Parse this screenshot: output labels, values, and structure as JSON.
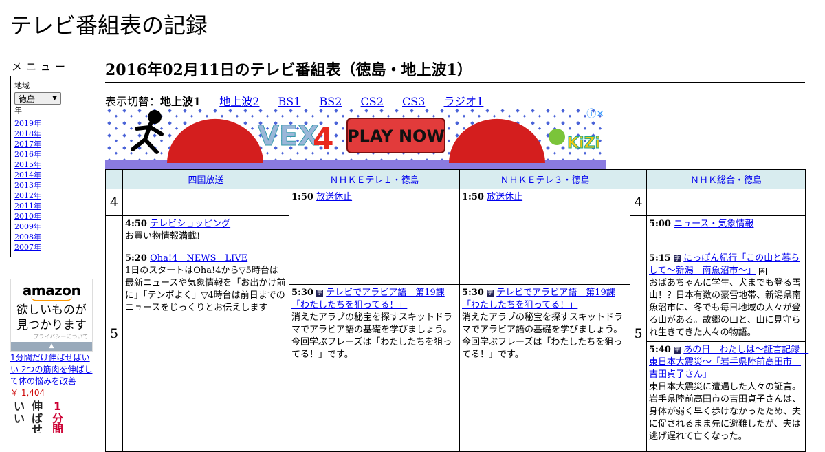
{
  "site_title": "テレビ番組表の記録",
  "menu": {
    "title": "メニュー",
    "region_label": "地域",
    "region_value": "徳島",
    "year_label": "年",
    "years": [
      "2019年",
      "2018年",
      "2017年",
      "2016年",
      "2015年",
      "2014年",
      "2013年",
      "2012年",
      "2011年",
      "2010年",
      "2009年",
      "2008年",
      "2007年"
    ]
  },
  "ads": {
    "amazon_logo": "amazon",
    "amazon_text_1": "欲しいものが",
    "amazon_text_2": "見つかります",
    "amazon_privacy": "プライバシーについて",
    "product_title": "1分間だけ伸ばせばいい 2つの筋肉を伸ばして体の悩みを改善",
    "product_price": "￥ 1,404",
    "book_cover_text": "いい 伸ばせ 1分間",
    "banner_play": "PLAY NOW",
    "banner_logo": "VEX 4",
    "banner_brand": "KiZi"
  },
  "heading": "2016年02月11日のテレビ番組表（徳島・地上波1）",
  "switcher": {
    "label": "表示切替：",
    "current": "地上波1",
    "links": [
      "地上波2",
      "BS1",
      "BS2",
      "CS2",
      "CS3",
      "ラジオ1"
    ]
  },
  "schedule": {
    "channels": [
      "四国放送",
      "ＮＨＫＥテレ１・徳島",
      "ＮＨＫＥテレ３・徳島",
      "ＮＨＫ総合・徳島"
    ],
    "hours": [
      "4",
      "5"
    ],
    "programs": {
      "ch1_a": {
        "time": "4:50",
        "title": "テレビショッピング",
        "desc": "お買い物情報満載!"
      },
      "ch1_b": {
        "time": "5:20",
        "title": "Oha!4　NEWS　LIVE",
        "desc": "1日のスタートはOha!4から▽5時台は最新ニュースや気象情報を「お出かけ前に」「テンポよく」▽4時台は前日までのニュースをじっくりとお伝えします"
      },
      "ch2_a": {
        "time": "1:50",
        "title": "放送休止"
      },
      "ch2_b": {
        "time": "5:30",
        "badge": "字",
        "title": "テレビでアラビア語　第19課「わたしたちを狙ってる！」",
        "desc": "消えたアラブの秘宝を探すスキットドラマでアラビア語の基礎を学びましょう。今回学ぶフレーズは「わたしたちを狙ってる！」です。"
      },
      "ch3_a": {
        "time": "1:50",
        "title": "放送休止"
      },
      "ch3_b": {
        "time": "5:30",
        "badge": "字",
        "title": "テレビでアラビア語　第19課「わたしたちを狙ってる！」",
        "desc": "消えたアラブの秘宝を探すスキットドラマでアラビア語の基礎を学びましょう。今回学ぶフレーズは「わたしたちを狙ってる！」です。"
      },
      "ch4_a": {
        "time": "5:00",
        "title": "ニュース・気象情報"
      },
      "ch4_b": {
        "time": "5:15",
        "badge": "字",
        "title": "にっぽん紀行「この山と暮らして～新潟　南魚沼市～」",
        "badge2": "再",
        "desc": "おばあちゃんに学生、犬までも登る雪山！？日本有数の豪雪地帯、新潟県南魚沼市に、冬でも毎日地域の人々が登る山がある。故郷の山と、山に見守られ生きてきた人々の物語。"
      },
      "ch4_c": {
        "time": "5:40",
        "badge": "字",
        "title": "あの日　わたしは～証言記録　東日本大震災～「岩手県陸前高田市　吉田貞子さん」",
        "desc": "東日本大震災に遭遇した人々の証言。岩手県陸前高田市の吉田貞子さんは、身体が弱く早く歩けなかったため、夫に促されるまま先に避難したが、夫は逃げ遅れて亡くなった。"
      }
    }
  }
}
